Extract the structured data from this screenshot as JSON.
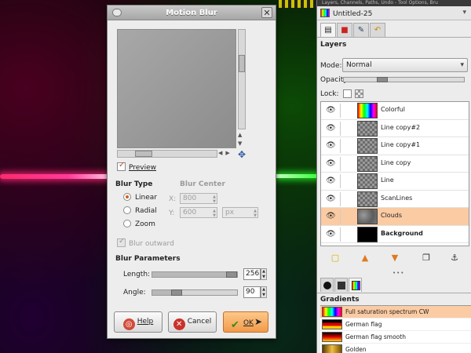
{
  "dialog": {
    "title": "Motion Blur",
    "preview_label": "Preview",
    "preview_checked": true,
    "blur_type": {
      "title": "Blur Type",
      "options": [
        "Linear",
        "Radial",
        "Zoom"
      ],
      "selected": "Linear"
    },
    "blur_center": {
      "title": "Blur Center",
      "x_label": "X:",
      "x_value": "800",
      "y_label": "Y:",
      "y_value": "600",
      "unit": "px"
    },
    "blur_outward_label": "Blur outward",
    "blur_params": {
      "title": "Blur Parameters",
      "length_label": "Length:",
      "length_value": "256",
      "length_fraction": 1.0,
      "angle_label": "Angle:",
      "angle_value": "90",
      "angle_fraction": 0.25
    },
    "buttons": {
      "help": "Help",
      "cancel": "Cancel",
      "ok": "OK"
    }
  },
  "dock": {
    "top_label": "Layers, Channels, Paths, Undo - Tool Options, Bru",
    "image_name": "Untitled-25",
    "layers_title": "Layers",
    "mode_label": "Mode:",
    "mode_value": "Normal",
    "opacity_label": "Opacity:",
    "opacity_fraction": 0.3,
    "lock_label": "Lock:",
    "layers": [
      {
        "name": "Colorful",
        "thumb": "spectrum",
        "selected": false,
        "bold": false
      },
      {
        "name": "Line copy#2",
        "thumb": "checker",
        "selected": false,
        "bold": false
      },
      {
        "name": "Line copy#1",
        "thumb": "checker",
        "selected": false,
        "bold": false
      },
      {
        "name": "Line copy",
        "thumb": "checker",
        "selected": false,
        "bold": false
      },
      {
        "name": "Line",
        "thumb": "checker",
        "selected": false,
        "bold": false
      },
      {
        "name": "ScanLines",
        "thumb": "checker",
        "selected": false,
        "bold": false
      },
      {
        "name": "Clouds",
        "thumb": "clouds",
        "selected": true,
        "bold": false
      },
      {
        "name": "Background",
        "thumb": "black",
        "selected": false,
        "bold": true
      }
    ],
    "gradients_title": "Gradients",
    "gradients": [
      {
        "name": "Full saturation spectrum CW",
        "selected": true
      },
      {
        "name": "German flag",
        "selected": false
      },
      {
        "name": "German flag smooth",
        "selected": false
      },
      {
        "name": "Golden",
        "selected": false
      }
    ]
  },
  "colors": {
    "selection": "#fbcba3",
    "ok_button": "#f29a4a",
    "accent_check": "#b5531b"
  }
}
